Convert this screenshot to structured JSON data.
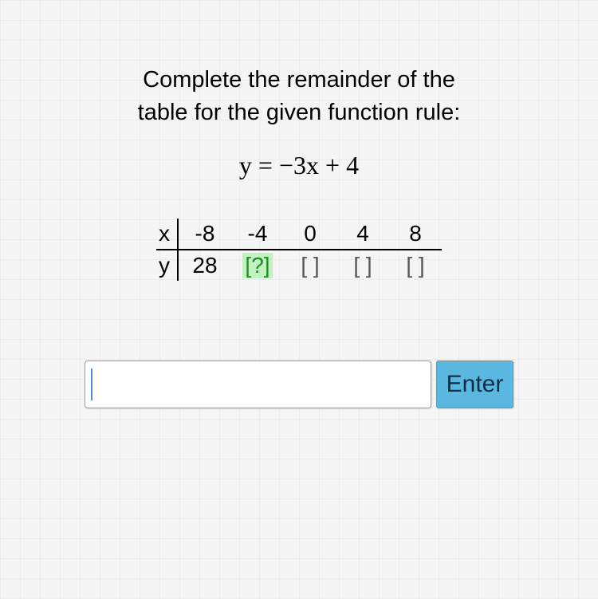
{
  "instruction_line1": "Complete the remainder of the",
  "instruction_line2": "table for the given function rule:",
  "equation": "y = −3x + 4",
  "table": {
    "x_label": "x",
    "y_label": "y",
    "x_values": [
      "-8",
      "-4",
      "0",
      "4",
      "8"
    ],
    "y_values": [
      "28",
      "[?]",
      "[ ]",
      "[ ]",
      "[ ]"
    ],
    "active_index": 1
  },
  "input": {
    "value": "",
    "placeholder": ""
  },
  "enter_label": "Enter",
  "chart_data": {
    "type": "table",
    "title": "Function table for y = -3x + 4",
    "columns": [
      "x",
      "y"
    ],
    "rows": [
      {
        "x": -8,
        "y": 28
      },
      {
        "x": -4,
        "y": null
      },
      {
        "x": 0,
        "y": null
      },
      {
        "x": 4,
        "y": null
      },
      {
        "x": 8,
        "y": null
      }
    ],
    "rule": "y = -3x + 4"
  }
}
